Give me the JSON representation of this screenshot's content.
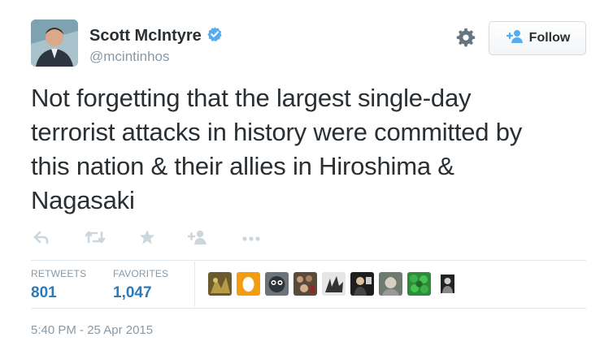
{
  "user": {
    "full_name": "Scott McIntyre",
    "handle": "@mcintinhos",
    "verified": true
  },
  "follow_button": {
    "label": "Follow"
  },
  "tweet": {
    "text_lines": [
      "Not forgetting that the largest single-day",
      "terrorist attacks in history were committed by",
      "this nation & their allies in Hiroshima &",
      "Nagasaki"
    ]
  },
  "actions": [
    "reply-icon",
    "retweet-icon",
    "favorite-icon",
    "follow-icon",
    "more-icon"
  ],
  "stats": {
    "retweets": {
      "label": "RETWEETS",
      "value": "801"
    },
    "favorites": {
      "label": "FAVORITES",
      "value": "1,047"
    }
  },
  "favoriters_count_shown": 9,
  "timestamp": "5:40 PM - 25 Apr 2015",
  "colors": {
    "text": "#292f33",
    "muted": "#8899a6",
    "link": "#2b7bb9",
    "verified": "#55acee",
    "divider": "#e1e8ed"
  }
}
